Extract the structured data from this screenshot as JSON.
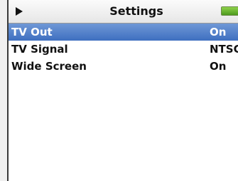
{
  "header": {
    "title": "Settings",
    "play_icon": "play-icon",
    "battery_icon": "battery-icon",
    "battery_color": "#5fb32a"
  },
  "menu": {
    "selected_color": "#4a7bc8",
    "items": [
      {
        "label": "TV Out",
        "value": "On",
        "selected": true
      },
      {
        "label": "TV Signal",
        "value": "NTSC",
        "selected": false
      },
      {
        "label": "Wide Screen",
        "value": "On",
        "selected": false
      }
    ]
  }
}
